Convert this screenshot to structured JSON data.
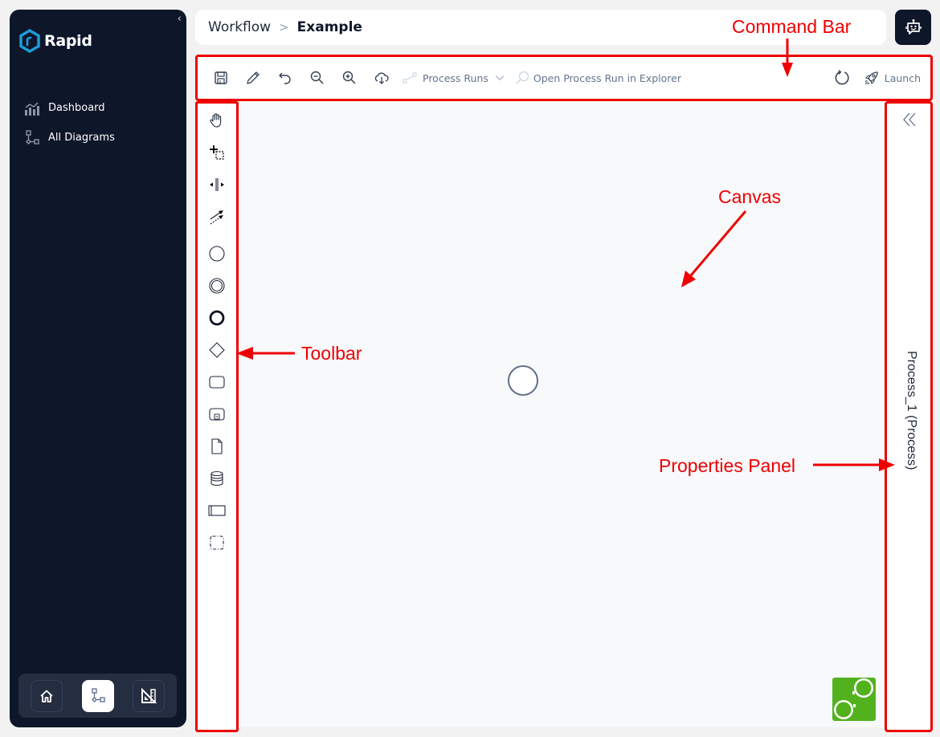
{
  "sidebar": {
    "brand": "Rapid",
    "collapse_icon": "chevron-left-icon",
    "items": [
      {
        "label": "Dashboard",
        "icon": "chart-icon"
      },
      {
        "label": "All Diagrams",
        "icon": "diagram-icon"
      }
    ],
    "bottom_tabs": [
      {
        "name": "home",
        "icon": "home-icon",
        "active": false
      },
      {
        "name": "diagrams",
        "icon": "diagram-icon",
        "active": true
      },
      {
        "name": "tools",
        "icon": "set-square-ruler-icon",
        "active": false
      }
    ]
  },
  "header": {
    "breadcrumb": [
      "Workflow",
      "Example"
    ],
    "separator": ">",
    "assistant_icon": "robot-chat-icon"
  },
  "command_bar": {
    "buttons": [
      {
        "name": "save",
        "icon": "save-icon"
      },
      {
        "name": "edit",
        "icon": "pencil-icon"
      },
      {
        "name": "undo",
        "icon": "undo-icon"
      },
      {
        "name": "zoom-out",
        "icon": "zoom-out-icon"
      },
      {
        "name": "zoom-in",
        "icon": "zoom-in-icon"
      },
      {
        "name": "download",
        "icon": "cloud-download-icon"
      }
    ],
    "process_runs_label": "Process Runs",
    "open_explorer_label": "Open Process Run in Explorer",
    "refresh_icon": "refresh-icon",
    "launch_label": "Launch"
  },
  "toolbar": {
    "tools": [
      "hand-tool",
      "lasso-tool",
      "space-tool",
      "global-connect-tool",
      "start-event",
      "intermediate-event",
      "end-event",
      "gateway",
      "task",
      "subprocess",
      "data-object",
      "data-store",
      "pool",
      "group"
    ]
  },
  "canvas": {
    "elements": [
      {
        "type": "start-event"
      }
    ]
  },
  "properties_panel": {
    "title": "Process_1 (Process)",
    "collapse_icon": "double-chevron-left-icon"
  },
  "annotations": {
    "command_bar": "Command Bar",
    "canvas": "Canvas",
    "toolbar": "Toolbar",
    "properties_panel": "Properties Panel",
    "color": "#ee0000"
  }
}
